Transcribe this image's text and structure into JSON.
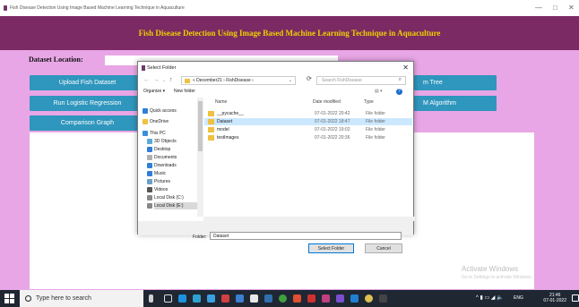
{
  "window": {
    "title": "Fish Disease Detection Using Image Based Machine Learning Technique in Aquaculture",
    "minimize": "—",
    "maximize": "□",
    "close": "✕"
  },
  "app": {
    "header": "Fish Disease Detection Using Image Based Machine Learning Technique in Aquaculture",
    "dataset_label": "Dataset Location:",
    "buttons": {
      "upload": "Upload Fish Dataset",
      "logistic": "Run Logistic Regression",
      "comparison": "Comparison Graph",
      "right1": "m Tree",
      "right2": "M Algorithm"
    },
    "watermark_title": "Activate Windows",
    "watermark_sub": "Go to Settings to activate Windows."
  },
  "dialog": {
    "title": "Select Folder",
    "close": "✕",
    "address": "« December21 › FishDisease ›",
    "search_placeholder": "Search FishDisease",
    "organize": "Organize ▾",
    "new_folder": "New folder",
    "sidebar": [
      {
        "label": "Quick access",
        "icon": "star-icon",
        "color": "#2f7fd8"
      },
      {
        "label": "OneDrive",
        "icon": "cloud-icon",
        "color": "#f0c040"
      },
      {
        "label": "This PC",
        "icon": "computer-icon",
        "color": "#3b8fd8"
      },
      {
        "label": "3D Objects",
        "icon": "cube-icon",
        "color": "#5aaad8"
      },
      {
        "label": "Desktop",
        "icon": "desktop-icon",
        "color": "#2f7fd8"
      },
      {
        "label": "Documents",
        "icon": "document-icon",
        "color": "#b0b0b0"
      },
      {
        "label": "Downloads",
        "icon": "download-icon",
        "color": "#2f7fd8"
      },
      {
        "label": "Music",
        "icon": "music-icon",
        "color": "#2f7fd8"
      },
      {
        "label": "Pictures",
        "icon": "picture-icon",
        "color": "#6aa0c8"
      },
      {
        "label": "Videos",
        "icon": "video-icon",
        "color": "#555"
      },
      {
        "label": "Local Disk (C:)",
        "icon": "disk-icon",
        "color": "#888"
      },
      {
        "label": "Local Disk (E:)",
        "icon": "disk-icon",
        "color": "#888"
      }
    ],
    "columns": [
      "Name",
      "Date modified",
      "Type"
    ],
    "files": [
      {
        "name": "__pycache__",
        "date": "07-01-2022 20:42",
        "type": "File folder"
      },
      {
        "name": "Dataset",
        "date": "07-01-2022 18:47",
        "type": "File folder"
      },
      {
        "name": "model",
        "date": "07-01-2022 19:02",
        "type": "File folder"
      },
      {
        "name": "testImages",
        "date": "07-01-2022 20:36",
        "type": "File folder"
      }
    ],
    "folder_label": "Folder:",
    "folder_value": "Dataset",
    "select_button": "Select Folder",
    "cancel_button": "Cancel"
  },
  "taskbar": {
    "search_placeholder": "Type here to search",
    "time": "21:46",
    "date": "07-01-2022",
    "lang": "ENG"
  }
}
